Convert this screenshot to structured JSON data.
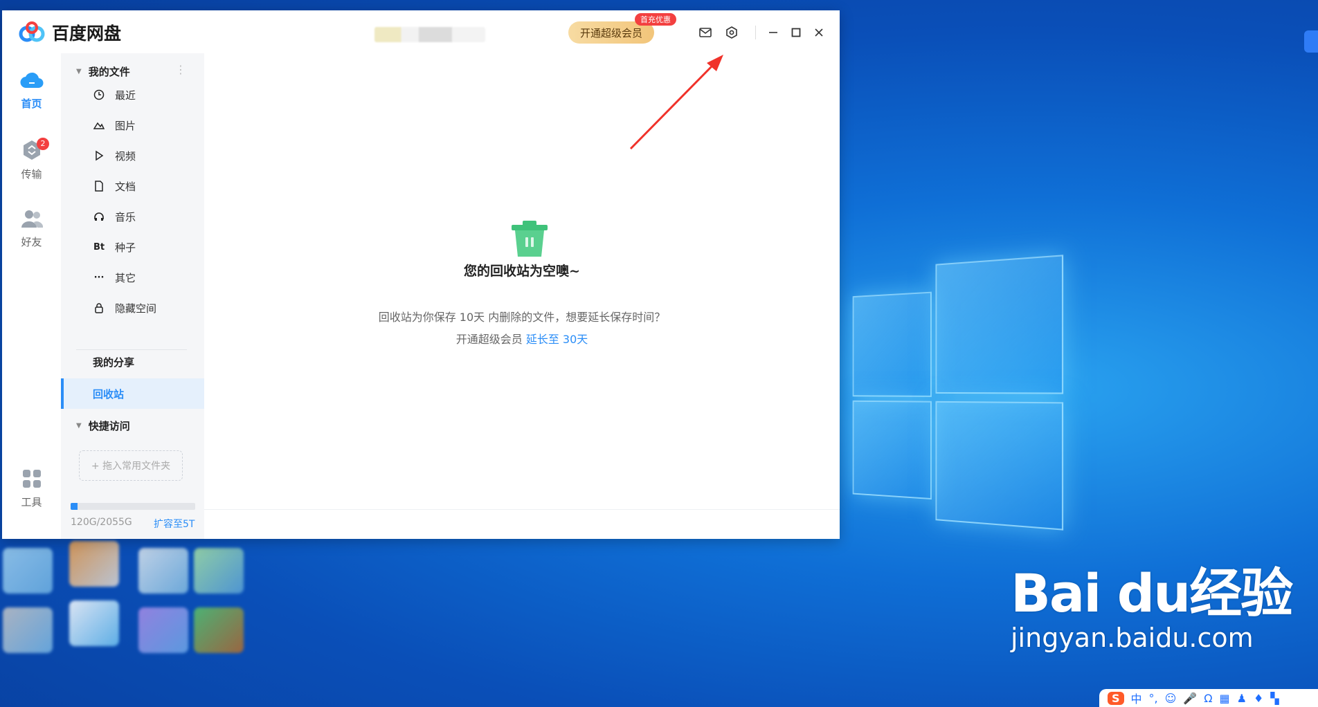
{
  "app": {
    "title": "百度网盘",
    "vip_button": "开通超级会员",
    "vip_badge": "首充优惠",
    "colors": {
      "accent": "#2a8df7",
      "badge_red": "#f34040",
      "vip_gold": "#f2c57a"
    }
  },
  "nav": {
    "home": "首页",
    "transfer": "传输",
    "transfer_count": "2",
    "friends": "好友",
    "tools": "工具"
  },
  "sidebar": {
    "my_files": "我的文件",
    "items": [
      {
        "label": "最近",
        "icon": "clock-icon"
      },
      {
        "label": "图片",
        "icon": "image-icon"
      },
      {
        "label": "视频",
        "icon": "play-icon"
      },
      {
        "label": "文档",
        "icon": "document-icon"
      },
      {
        "label": "音乐",
        "icon": "headphones-icon"
      },
      {
        "label": "种子",
        "icon": "bt-icon",
        "glyph": "Bt"
      },
      {
        "label": "其它",
        "icon": "more-icon",
        "glyph": "···"
      },
      {
        "label": "隐藏空间",
        "icon": "lock-icon"
      }
    ],
    "my_share": "我的分享",
    "recycle_bin": "回收站",
    "quick_access": "快捷访问",
    "drop_folder": "+ 拖入常用文件夹",
    "storage_used": "120G/2055G",
    "storage_fraction": 0.058,
    "expand_link": "扩容至5T"
  },
  "main": {
    "empty_title": "您的回收站为空噢~",
    "empty_desc": "回收站为你保存 10天 内删除的文件，想要延长保存时间？",
    "cta_prefix": "开通超级会员",
    "cta_link": "延长至 30天"
  },
  "watermark": {
    "brand": "Bai du经验",
    "url": "jingyan.baidu.com"
  },
  "ime": {
    "logo": "S",
    "mode": "中",
    "punct": "°,"
  }
}
